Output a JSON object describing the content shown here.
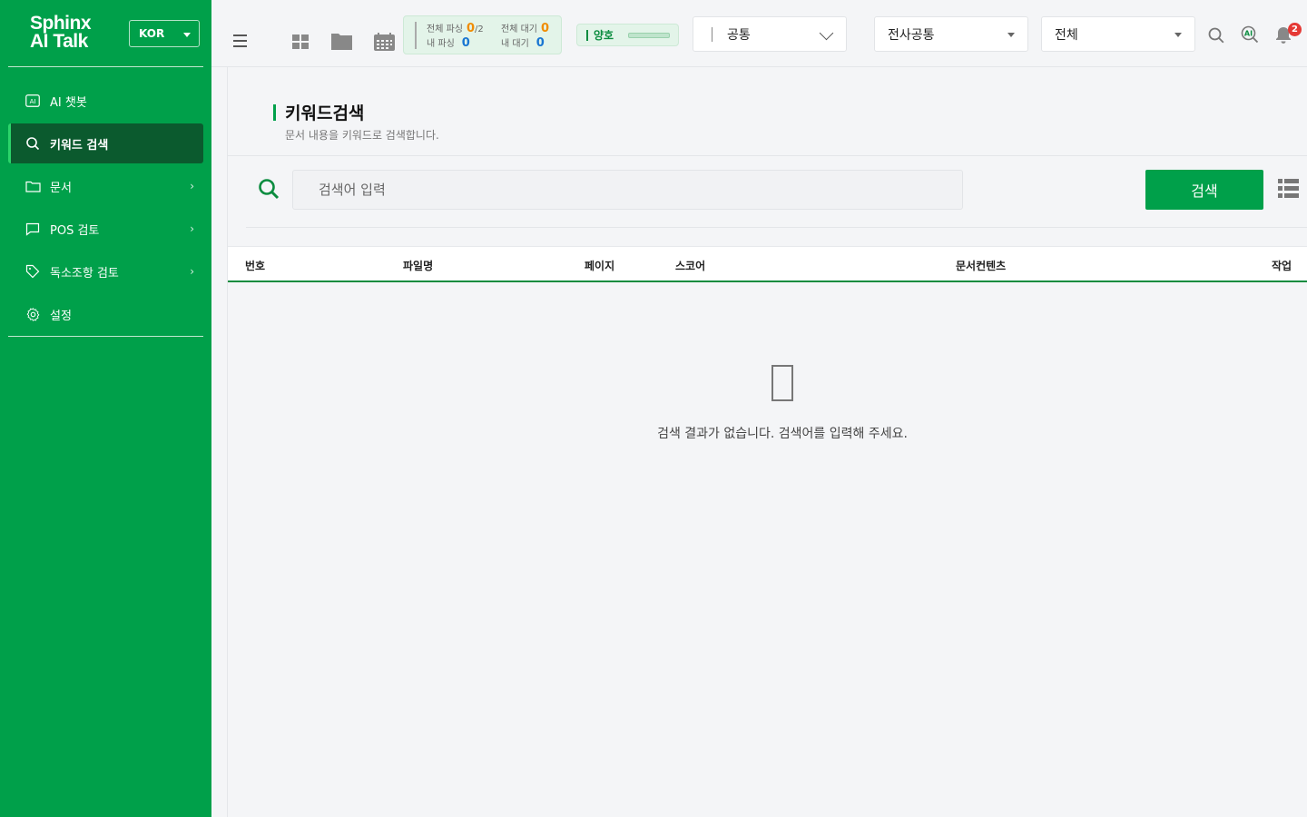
{
  "sidebar": {
    "brand_line1": "Sphinx",
    "brand_line2": "AI Talk",
    "language": "KOR",
    "items": [
      {
        "label": "AI 챗봇",
        "icon": "ai-icon",
        "active": false,
        "has_children": false
      },
      {
        "label": "키워드 검색",
        "icon": "search-icon",
        "active": true,
        "has_children": false
      },
      {
        "label": "문서",
        "icon": "folder-icon",
        "active": false,
        "has_children": true
      },
      {
        "label": "POS 검토",
        "icon": "chat-icon",
        "active": false,
        "has_children": true
      },
      {
        "label": "독소조항 검토",
        "icon": "tag-icon",
        "active": false,
        "has_children": true
      },
      {
        "label": "설정",
        "icon": "gear-icon",
        "active": false,
        "has_children": false
      }
    ],
    "colors": {
      "background": "#00a04a",
      "active": "#0b5a2e"
    }
  },
  "topbar": {
    "status": {
      "total_parsing_label": "전체 파싱",
      "total_parsing_value": "0",
      "total_parsing_max": "/2",
      "my_parsing_label": "내 파싱",
      "my_parsing_value": "0",
      "total_waiting_label": "전체 대기",
      "total_waiting_value": "0",
      "my_waiting_label": "내 대기",
      "my_waiting_value": "0"
    },
    "health_label": "양호",
    "select_scope": "공통",
    "select_company": "전사공통",
    "select_filter": "전체",
    "notification_count": "2",
    "ai_badge": "AI"
  },
  "page": {
    "title": "키워드검색",
    "subtitle": "문서 내용을 키워드로 검색합니다.",
    "search_placeholder": "검색어 입력",
    "search_value": "",
    "search_button": "검색"
  },
  "table": {
    "columns": [
      "번호",
      "파일명",
      "페이지",
      "스코어",
      "문서컨텐츠",
      "작업"
    ],
    "rows": [],
    "empty_message": "검색 결과가 없습니다. 검색어를 입력해 주세요."
  },
  "colors": {
    "accent": "#00a04a",
    "accent_dark": "#0b8c3f",
    "warning": "#f08c00",
    "info": "#1976d2",
    "alert": "#e53935"
  }
}
